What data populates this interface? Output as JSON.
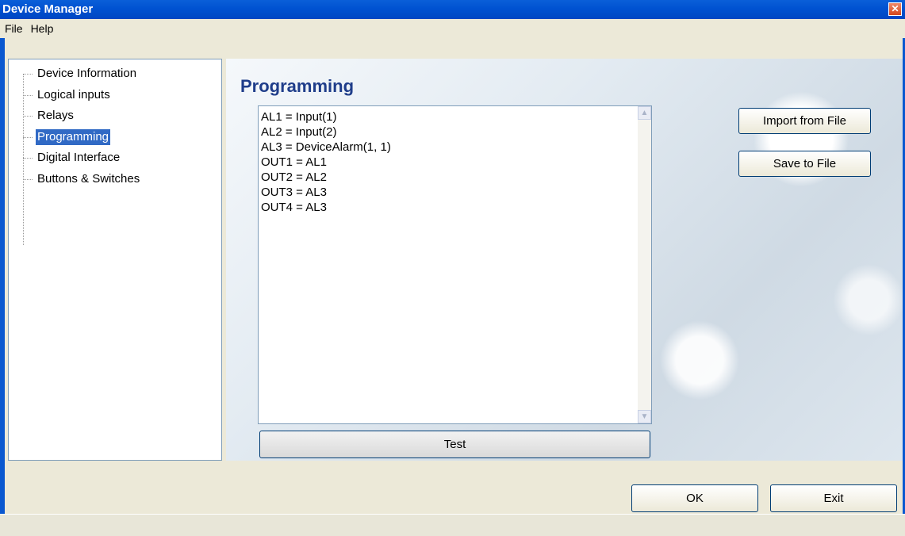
{
  "window": {
    "title": "Device Manager",
    "close_glyph": "✕"
  },
  "menu": {
    "items": [
      "File",
      "Help"
    ]
  },
  "tree": {
    "items": [
      {
        "label": "Device Information",
        "selected": false
      },
      {
        "label": "Logical inputs",
        "selected": false
      },
      {
        "label": "Relays",
        "selected": false
      },
      {
        "label": "Programming",
        "selected": true
      },
      {
        "label": "Digital Interface",
        "selected": false
      },
      {
        "label": "Buttons & Switches",
        "selected": false
      }
    ]
  },
  "content": {
    "title": "Programming",
    "editor_lines": [
      "AL1 = Input(1)",
      "AL2 = Input(2)",
      "AL3 = DeviceAlarm(1, 1)",
      "OUT1 = AL1",
      "OUT2 = AL2",
      "OUT3 = AL3",
      "OUT4 = AL3"
    ],
    "test_label": "Test",
    "import_label": "Import from File",
    "save_label": "Save to File"
  },
  "footer": {
    "ok_label": "OK",
    "exit_label": "Exit"
  },
  "colors": {
    "title_bar": "#0052d1",
    "selection": "#316ac5",
    "heading": "#1f3d8a"
  }
}
